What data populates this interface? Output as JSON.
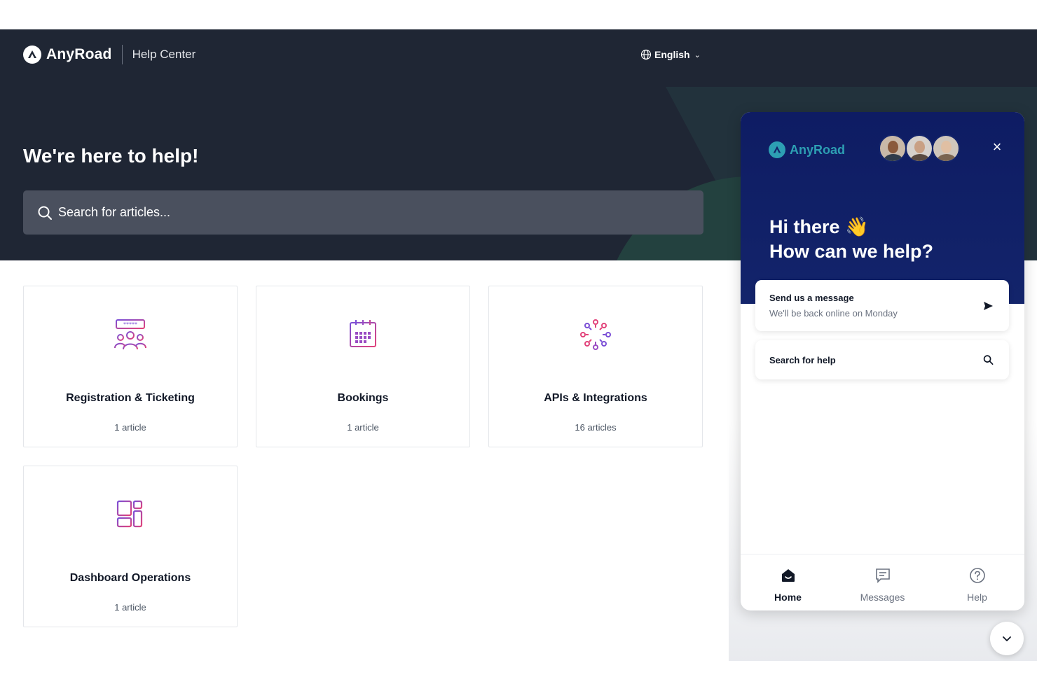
{
  "header": {
    "brand": "AnyRoad",
    "section": "Help Center",
    "language": "English"
  },
  "hero": {
    "title": "We're here to help!",
    "search_placeholder": "Search for articles..."
  },
  "collections": [
    {
      "title": "Registration & Ticketing",
      "count": "1 article",
      "icon": "people-ticket-icon"
    },
    {
      "title": "Bookings",
      "count": "1 article",
      "icon": "calendar-icon"
    },
    {
      "title": "APIs & Integrations",
      "count": "16 articles",
      "icon": "integrations-icon"
    },
    {
      "title": "Dashboard Operations",
      "count": "1 article",
      "icon": "dashboard-icon"
    }
  ],
  "messenger": {
    "brand": "AnyRoad",
    "greeting_line1": "Hi there 👋",
    "greeting_line2": "How can we help?",
    "send_message": {
      "title": "Send us a message",
      "subtitle": "We'll be back online on Monday"
    },
    "search_help": "Search for help",
    "nav": {
      "home": "Home",
      "messages": "Messages",
      "help": "Help"
    }
  },
  "colors": {
    "hero_bg": "#1f2634",
    "messenger_header": "#0e1c63",
    "accent_teal": "#2d9fb3",
    "icon_pink": "#e2437a",
    "icon_purple": "#7b4fd6"
  }
}
